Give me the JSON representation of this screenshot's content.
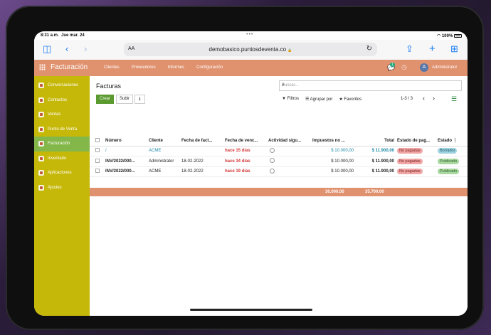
{
  "status": {
    "time": "8:31 a.m.",
    "date": "Jue mar. 24",
    "battery": "100%"
  },
  "browser": {
    "text_size": "AA",
    "url": "demobasico.puntosdeventa.co",
    "lock": "🔒",
    "reload": "↻"
  },
  "nav": {
    "brand": "Facturación",
    "menu": [
      "Clientes",
      "Proveedores",
      "Informes",
      "Configuración"
    ],
    "chat_count": "1",
    "user_initial": "A",
    "user": "Administrator"
  },
  "sidebar": {
    "items": [
      {
        "label": "Conversaciones",
        "icon": "chat-icon"
      },
      {
        "label": "Contactos",
        "icon": "contacts-icon"
      },
      {
        "label": "Ventas",
        "icon": "chart-icon"
      },
      {
        "label": "Punto de Venta",
        "icon": "pos-icon"
      },
      {
        "label": "Facturación",
        "icon": "invoice-icon",
        "active": true
      },
      {
        "label": "Inventario",
        "icon": "box-icon"
      },
      {
        "label": "Aplicaciones",
        "icon": "apps-icon"
      },
      {
        "label": "Ajustes",
        "icon": "gear-icon"
      }
    ]
  },
  "main": {
    "title": "Facturas",
    "search_placeholder": "Buscar...",
    "buttons": {
      "create": "Crear",
      "upload": "Subir",
      "download": "⭳"
    },
    "filters": {
      "filters": "Filtros",
      "group": "Agrupar por",
      "favorites": "Favoritos"
    },
    "pager": "1-3 / 3",
    "columns": [
      "Número",
      "Cliente",
      "Fecha de fact...",
      "Fecha de venc...",
      "Actividad sigu...",
      "Impuestos no ...",
      "Total",
      "Estado de pag...",
      "Estado"
    ],
    "rows": [
      {
        "number": "/",
        "client": "ACME",
        "inv_date": "",
        "due": "hace 15 días",
        "tax": "$ 10.000,00",
        "total": "$ 11.900,00",
        "pay_state": "No pagadas",
        "state": "Borrador"
      },
      {
        "number": "INV/2022/000...",
        "client": "Administrator",
        "inv_date": "18-02-2022",
        "due": "hace 34 días",
        "tax": "$ 10.000,00",
        "total": "$ 11.900,00",
        "pay_state": "No pagadas",
        "state": "Publicado"
      },
      {
        "number": "INV/2022/000...",
        "client": "ACME",
        "inv_date": "18-02-2022",
        "due": "hace 19 días",
        "tax": "$ 10.000,00",
        "total": "$ 11.900,00",
        "pay_state": "No pagadas",
        "state": "Publicado"
      }
    ],
    "totals": {
      "tax": "30.000,00",
      "total": "35.700,00"
    }
  },
  "colors": {
    "topbar": "#e0916e",
    "sidebar": "#c6b809",
    "sidebar_active": "#84b74a",
    "primary_button": "#5a9a2f"
  }
}
